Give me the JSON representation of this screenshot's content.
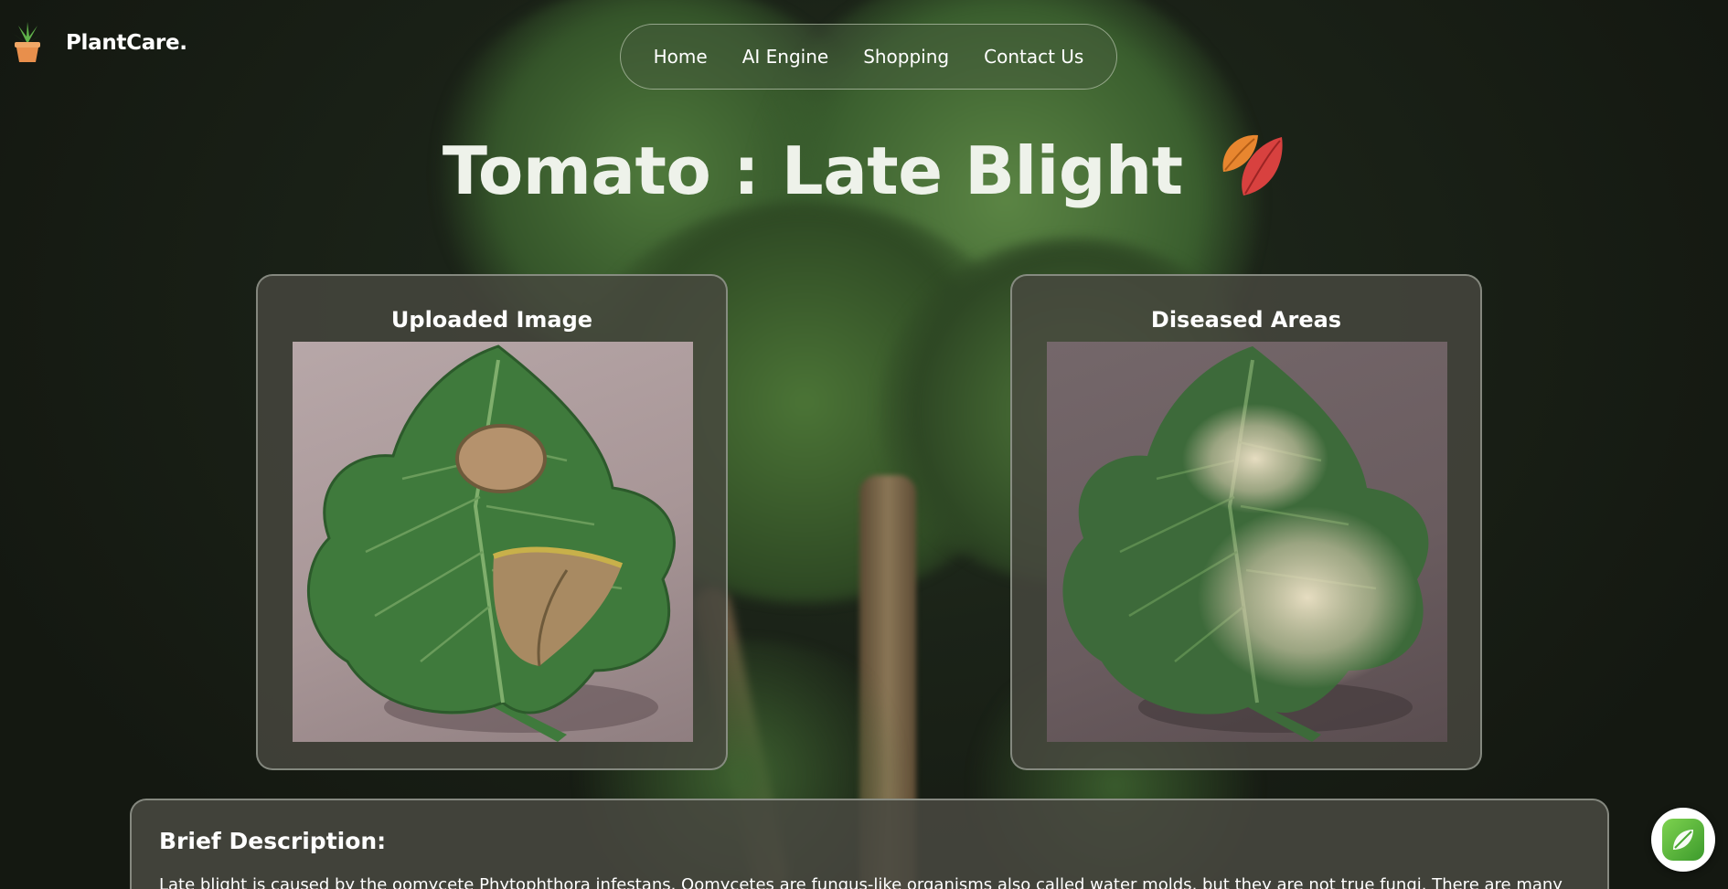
{
  "brand": {
    "name": "PlantCare."
  },
  "nav": {
    "items": [
      "Home",
      "AI Engine",
      "Shopping",
      "Contact Us"
    ]
  },
  "page_title": "Tomato : Late Blight",
  "cards": {
    "uploaded": {
      "heading": "Uploaded Image"
    },
    "diseased": {
      "heading": "Diseased Areas"
    }
  },
  "description": {
    "heading": "Brief Description:",
    "text": "Late blight is caused by the oomycete Phytophthora infestans. Oomycetes are fungus-like organisms also called water molds, but they are not true fungi. There are many"
  },
  "icons": {
    "logo": "potted-plant-icon",
    "title": "fallen-leaf-icon",
    "fab": "leaf-icon"
  },
  "colors": {
    "accent_green": "#5cb83a",
    "title_leaf_orange": "#e8862f",
    "title_leaf_red": "#d8413f"
  }
}
